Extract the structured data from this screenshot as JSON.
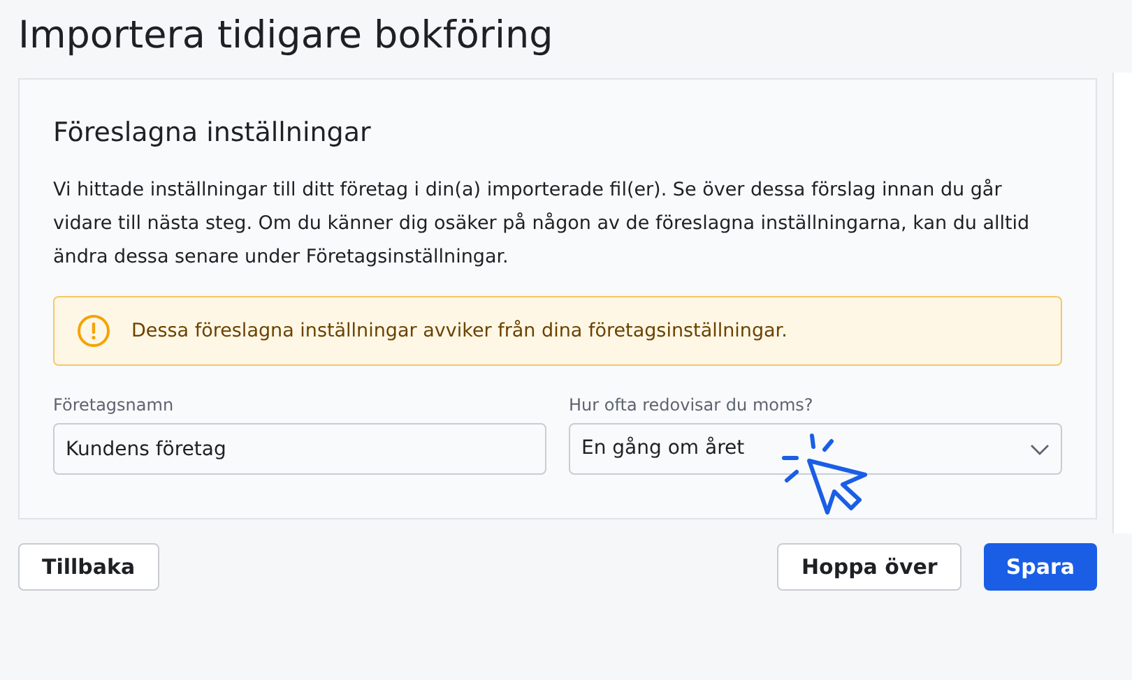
{
  "page": {
    "title": "Importera tidigare bokföring"
  },
  "card": {
    "heading": "Föreslagna inställningar",
    "description": "Vi hittade inställningar till ditt företag i din(a) importerade fil(er). Se över dessa förslag innan du går vidare till nästa steg. Om du känner dig osäker på någon av de föreslagna inställningarna, kan du alltid ändra dessa senare under Företagsinställningar.",
    "warning": {
      "kind": "warning",
      "text": "Dessa föreslagna inställningar avviker från dina företagsinställningar."
    },
    "fields": [
      {
        "kind": "text",
        "label": "Företagsnamn",
        "value": "Kundens företag"
      },
      {
        "kind": "select",
        "label": "Hur ofta redovisar du moms?",
        "value": "En gång om året"
      }
    ]
  },
  "buttons": [
    {
      "kind": "secondary",
      "label": "Tillbaka"
    },
    {
      "kind": "secondary",
      "label": "Hoppa över"
    },
    {
      "kind": "primary",
      "label": "Spara"
    }
  ]
}
